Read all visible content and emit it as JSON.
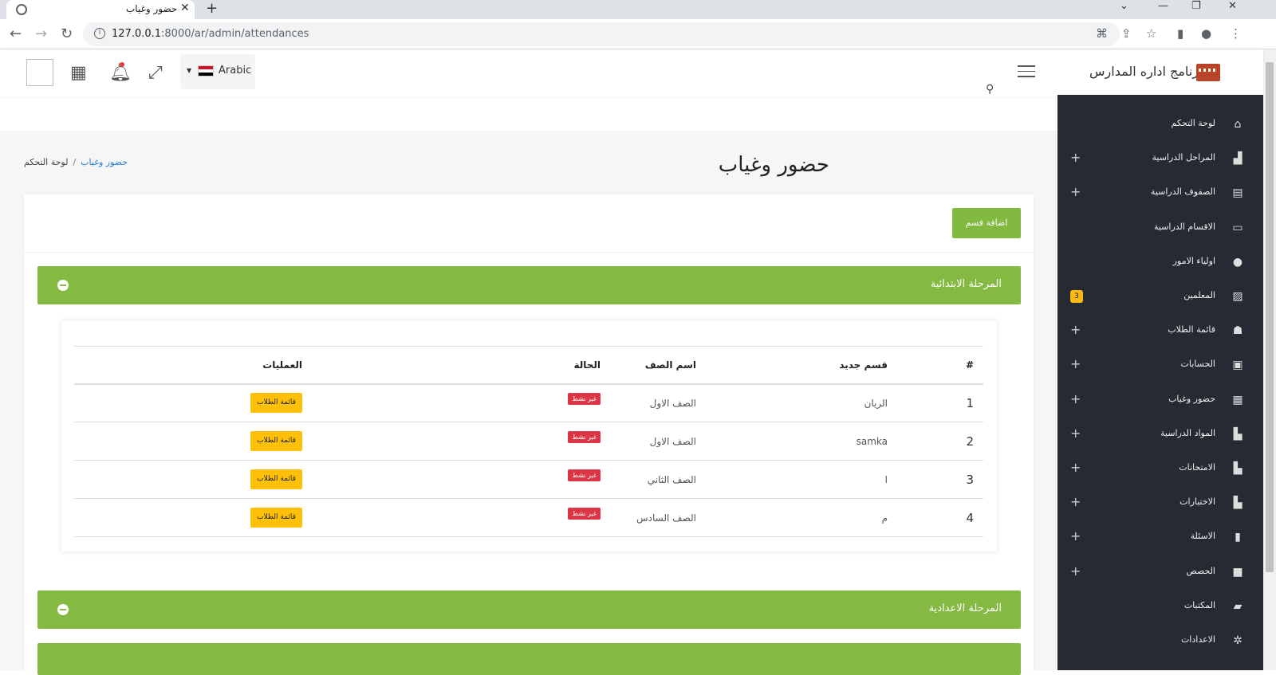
{
  "browser": {
    "tab_title": "حضور وغياب",
    "url_host": "127.0.0.1",
    "url_rest": ":8000/ar/admin/attendances"
  },
  "header": {
    "language": "Arabic",
    "brand": "برنامج اداره المدارس"
  },
  "sidebar": {
    "items": [
      {
        "label": "لوحة التحكم",
        "icon": "home-icon",
        "expandable": false
      },
      {
        "label": "المراحل الدراسية",
        "icon": "school-icon",
        "expandable": true
      },
      {
        "label": "الصفوف الدراسية",
        "icon": "building-icon",
        "expandable": true
      },
      {
        "label": "الاقسام الدراسية",
        "icon": "laptop-icon",
        "expandable": false
      },
      {
        "label": "اولياء الامور",
        "icon": "user-icon",
        "expandable": false
      },
      {
        "label": "المعلمين",
        "icon": "teacher-icon",
        "expandable": false,
        "badge": "3"
      },
      {
        "label": "قائمة الطلاب",
        "icon": "student-icon",
        "expandable": true
      },
      {
        "label": "الحسابات",
        "icon": "money-icon",
        "expandable": true
      },
      {
        "label": "حضور وغياب",
        "icon": "calendar-icon",
        "expandable": true
      },
      {
        "label": "المواد الدراسية",
        "icon": "book-open-icon",
        "expandable": true
      },
      {
        "label": "الامتحانات",
        "icon": "book-open-icon",
        "expandable": true
      },
      {
        "label": "الاختبارات",
        "icon": "book-open-icon",
        "expandable": true
      },
      {
        "label": "الاسئلة",
        "icon": "book-icon",
        "expandable": true
      },
      {
        "label": "الحصص",
        "icon": "video-icon",
        "expandable": true
      },
      {
        "label": "المكتبات",
        "icon": "notebook-icon",
        "expandable": false
      },
      {
        "label": "الاعدادات",
        "icon": "gears-icon",
        "expandable": false
      }
    ]
  },
  "page": {
    "title": "حضور وغياب",
    "breadcrumb_home": "لوحة التحكم",
    "breadcrumb_current": "حضور وغياب",
    "add_button": "اضافة قسم"
  },
  "stages": [
    {
      "title": "المرحلة الابتدائية"
    },
    {
      "title": "المرحلة الاعدادية"
    }
  ],
  "table": {
    "headers": [
      "#",
      "قسم جديد",
      "اسم الصف",
      "الحالة",
      "العمليات"
    ],
    "rows": [
      {
        "num": "1",
        "section": "الريان",
        "grade": "الصف الاول",
        "status": "غير نشط",
        "action": "قائمة الطلاب"
      },
      {
        "num": "2",
        "section": "samka",
        "grade": "الصف الاول",
        "status": "غير نشط",
        "action": "قائمة الطلاب"
      },
      {
        "num": "3",
        "section": "ا",
        "grade": "الصف الثاني",
        "status": "غير نشط",
        "action": "قائمة الطلاب"
      },
      {
        "num": "4",
        "section": "م",
        "grade": "الصف السادس",
        "status": "غير نشط",
        "action": "قائمة الطلاب"
      }
    ]
  },
  "colors": {
    "accent": "#84b942",
    "sidebar": "#262b33",
    "danger": "#dc3545",
    "warning": "#ffc107"
  }
}
